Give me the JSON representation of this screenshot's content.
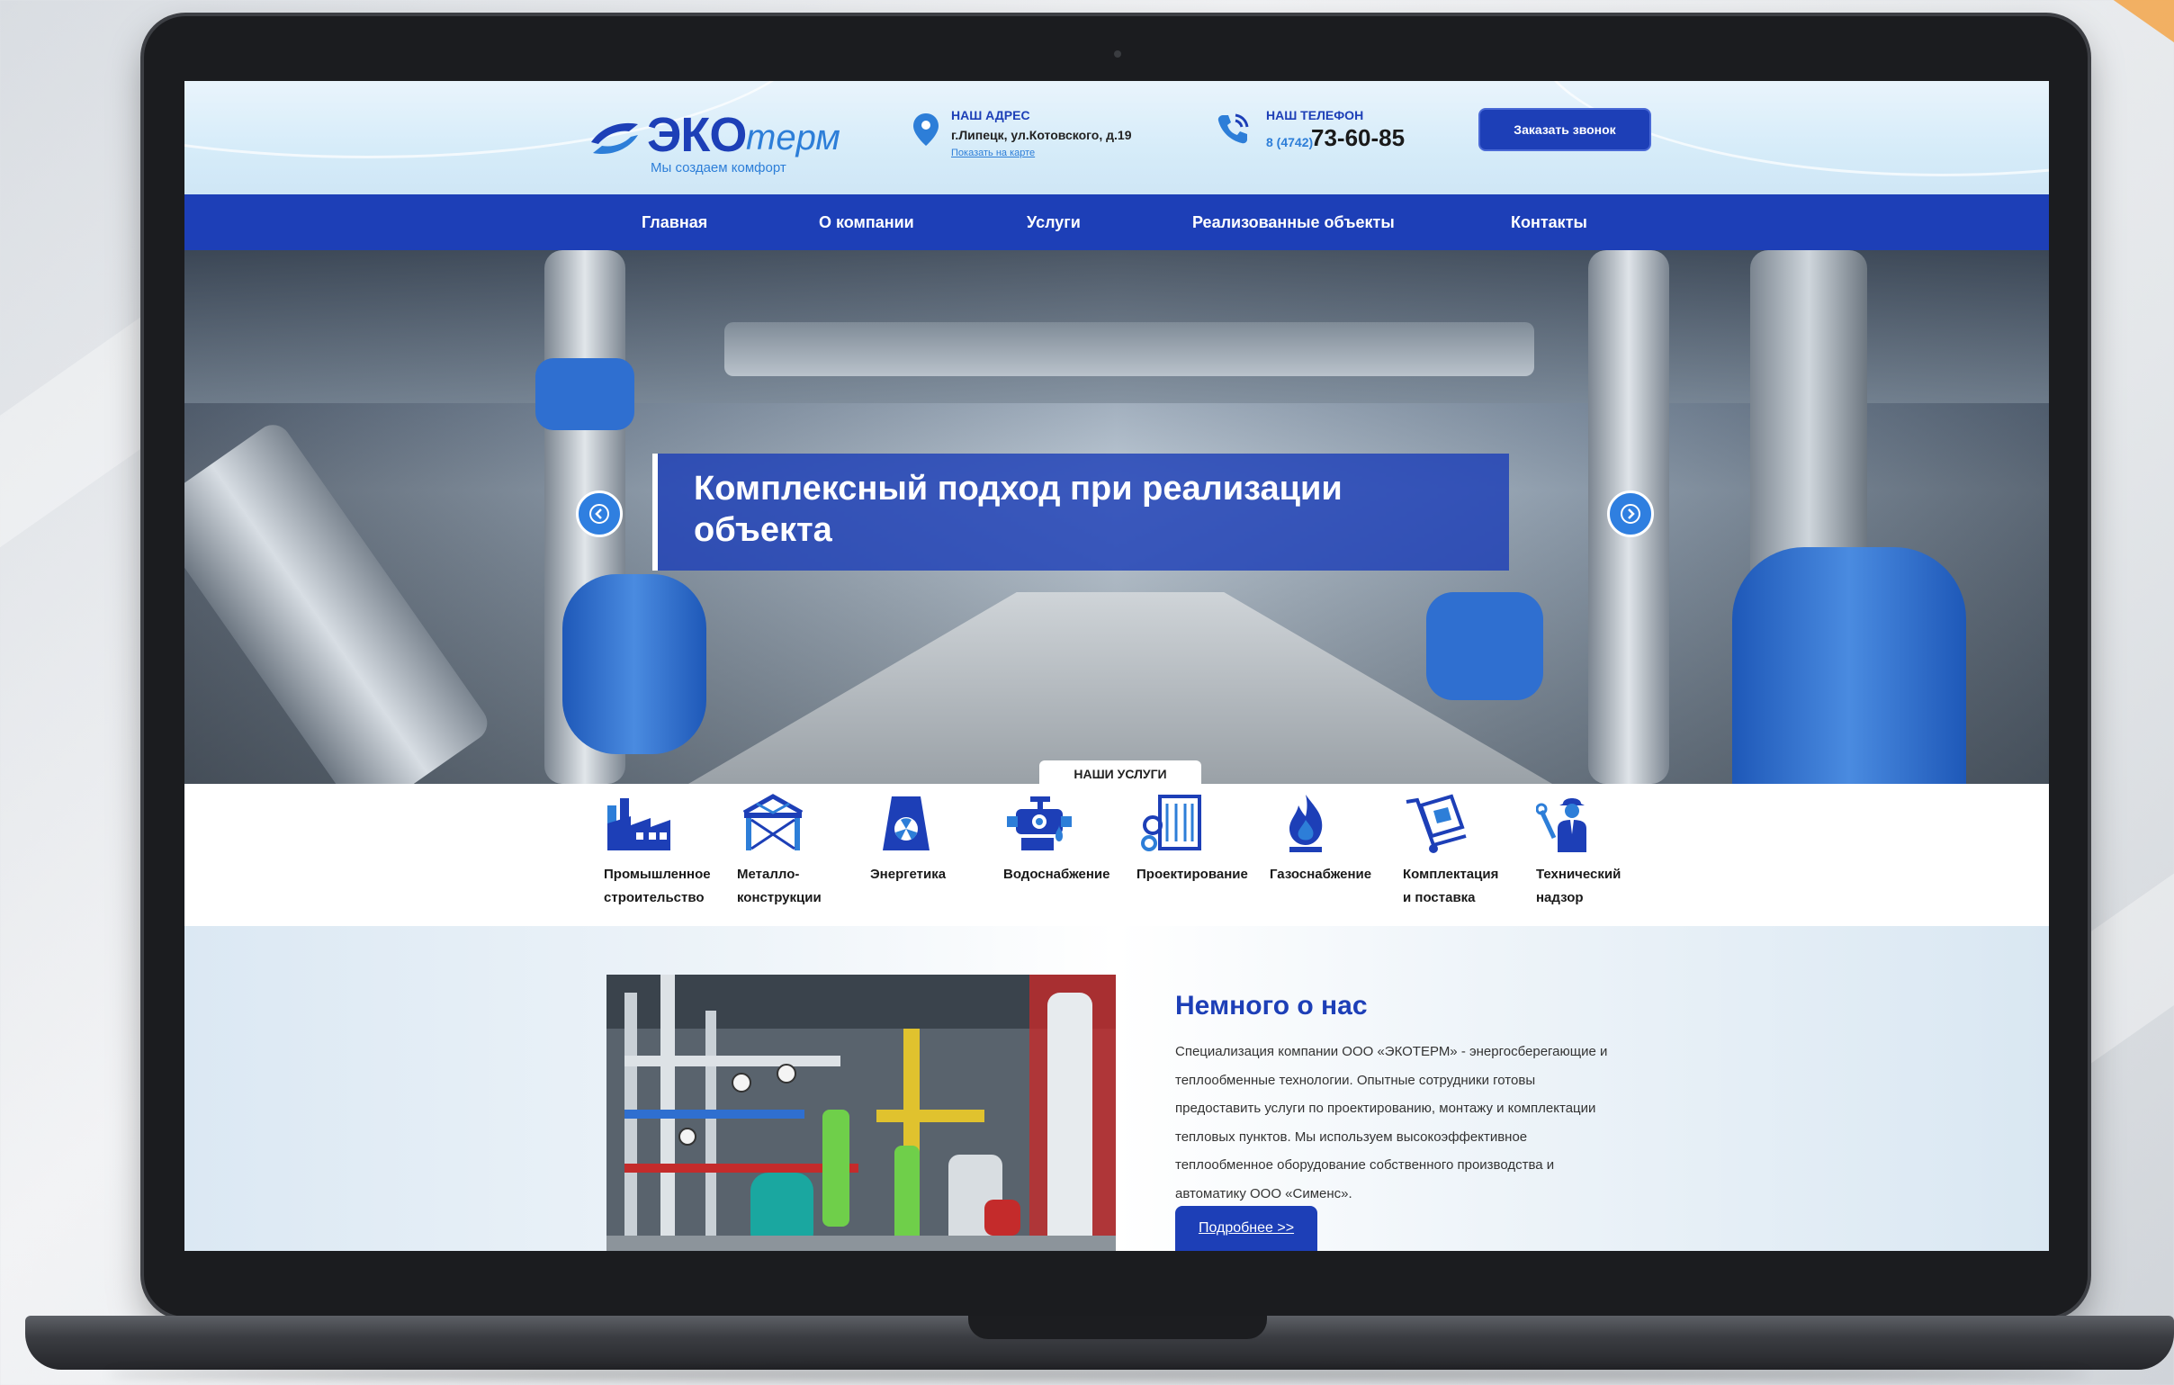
{
  "header": {
    "logo": {
      "brand_bold": "ЭКО",
      "brand_light": "терм",
      "slogan": "Мы создаем комфорт"
    },
    "address": {
      "title": "НАШ АДРЕС",
      "text": "г.Липецк, ул.Котовского, д.19",
      "map_link": "Показать на карте"
    },
    "phone": {
      "title": "НАШ ТЕЛЕФОН",
      "prefix": "8 (4742)",
      "number": "73-60-85"
    },
    "callback_button": "Заказать звонок"
  },
  "nav": {
    "items": [
      {
        "label": "Главная"
      },
      {
        "label": "О компании"
      },
      {
        "label": "Услуги"
      },
      {
        "label": "Реализованные объекты"
      },
      {
        "label": "Контакты"
      }
    ]
  },
  "hero": {
    "caption": "Комплексный подход при реализации объекта",
    "prev_icon": "chevron-left-icon",
    "next_icon": "chevron-right-icon"
  },
  "services": {
    "tab_label": "НАШИ УСЛУГИ",
    "items": [
      {
        "line1": "Промышленное",
        "line2": "строительство",
        "icon": "factory-icon"
      },
      {
        "line1": "Металло-",
        "line2": "конструкции",
        "icon": "metal-frame-icon"
      },
      {
        "line1": "Энергетика",
        "line2": "",
        "icon": "energy-icon"
      },
      {
        "line1": "Водоснабжение",
        "line2": "",
        "icon": "water-tap-icon"
      },
      {
        "line1": "Проектирование",
        "line2": "",
        "icon": "design-blueprint-icon"
      },
      {
        "line1": "Газоснабжение",
        "line2": "",
        "icon": "gas-flame-icon"
      },
      {
        "line1": "Комплектация",
        "line2": "и поставка",
        "icon": "delivery-cart-icon"
      },
      {
        "line1": "Технический",
        "line2": "надзор",
        "icon": "engineer-icon"
      }
    ]
  },
  "about": {
    "title": "Немного о нас",
    "text": "Специализация компании ООО «ЭКОТЕРМ» - энергосберегающие и теплообменные технологии. Опытные сотрудники готовы предоставить услуги по проектированию, монтажу и комплектации тепловых пунктов. Мы используем высокоэффективное теплообменное оборудование собственного производства и автоматику ООО «Сименс».",
    "more_button": "Подробнее >>"
  },
  "colors": {
    "brand_blue": "#1d3fb7",
    "accent_blue": "#2d7ed8",
    "header_bg": "#dbeefb"
  }
}
